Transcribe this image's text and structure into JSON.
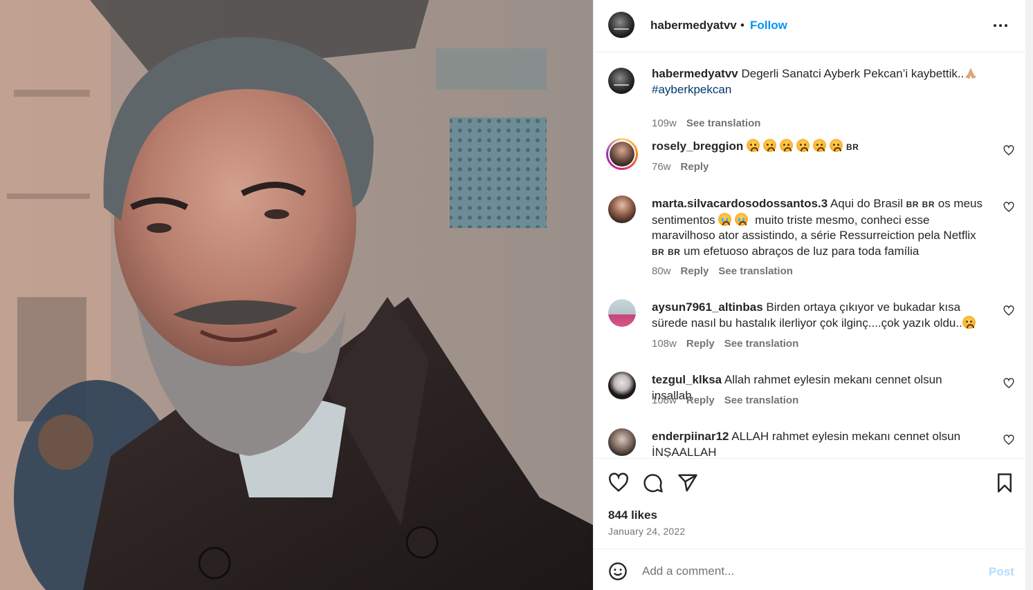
{
  "post": {
    "username": "habermedyatvv",
    "separator": "•",
    "follow_label": "Follow",
    "more_icon": "more-horizontal-icon",
    "image_icon": "post-photo"
  },
  "caption": {
    "username": "habermedyatvv",
    "text": "Degerli Sanatci Ayberk Pekcan’i kaybettik..",
    "emoji": "folded-hands",
    "hashtag": "#ayberkpekcan",
    "age": "109w",
    "see_translation": "See translation"
  },
  "comments": [
    {
      "username": "rosely_breggion",
      "text": "",
      "emoji_count": 6,
      "flag": "BR",
      "age": "76w",
      "reply": "Reply",
      "see_translation": ""
    },
    {
      "username": "marta.silvacardosodossantos.3",
      "line1": "Aqui do Brasil",
      "flag1": "BR",
      "flag2": "BR",
      "line1b": "os meus",
      "line2a": "sentimentos",
      "line2b": "muito triste mesmo, conheci esse",
      "line3": "maravilhoso ator assistindo, a série Ressurreiction pela Netflix",
      "flag3": "BR",
      "flag4": "BR",
      "line4": "um efetuoso abraços de luz para toda família",
      "age": "80w",
      "reply": "Reply",
      "see_translation": "See translation"
    },
    {
      "username": "aysun7961_altinbas",
      "line1": "Birden ortaya çıkıyor ve bukadar kısa",
      "line2": "sürede nasıl bu hastalık ilerliyor çok ilginç....çok yazık oldu..",
      "age": "108w",
      "reply": "Reply",
      "see_translation": "See translation"
    },
    {
      "username": "tezgul_klksa",
      "text": "Allah rahmet eylesin mekanı cennet olsun insallah",
      "age": "108w",
      "reply": "Reply",
      "see_translation": "See translation"
    },
    {
      "username": "enderpiinar12",
      "line1": "ALLAH rahmet eylesin mekanı cennet olsun",
      "line2": "İNŞAALLAH"
    }
  ],
  "actions": {
    "like_icon": "heart-icon",
    "comment_icon": "comment-icon",
    "share_icon": "send-icon",
    "save_icon": "bookmark-icon",
    "likes": "844 likes",
    "date": "January 24, 2022"
  },
  "add_comment": {
    "placeholder": "Add a comment...",
    "post_label": "Post",
    "emoji_icon": "emoji-icon"
  },
  "colors": {
    "link_blue": "#0095f6",
    "post_disabled": "#b3dbff",
    "secondary_text": "#737373",
    "hashtag": "#00376b"
  }
}
